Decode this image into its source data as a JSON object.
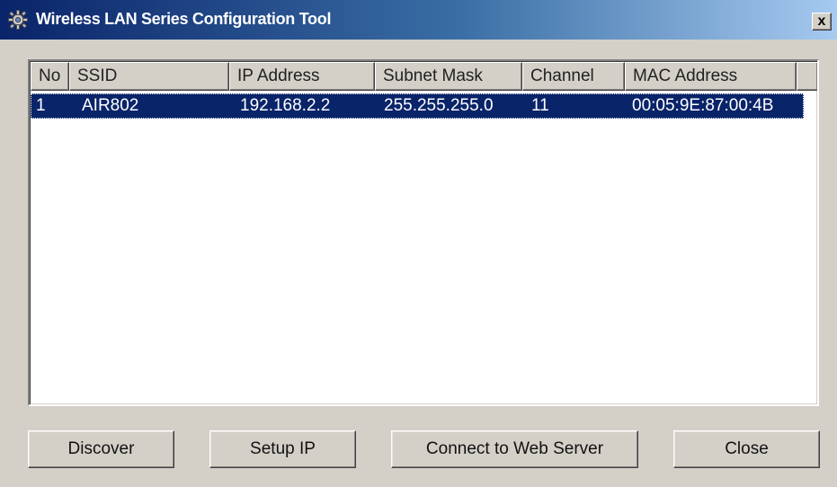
{
  "window": {
    "title": "Wireless LAN Series Configuration Tool",
    "close_label": "x"
  },
  "table": {
    "columns": [
      "No",
      "SSID",
      "IP Address",
      "Subnet Mask",
      "Channel",
      "MAC Address"
    ],
    "rows": [
      {
        "no": "1",
        "ssid": "AIR802",
        "ip": "192.168.2.2",
        "mask": "255.255.255.0",
        "channel": "11",
        "mac": "00:05:9E:87:00:4B",
        "selected": true
      }
    ]
  },
  "buttons": {
    "discover": "Discover",
    "setup_ip": "Setup IP",
    "connect": "Connect to Web Server",
    "close": "Close"
  },
  "colors": {
    "selection": "#0a246a",
    "face": "#d4d0c8",
    "title_start": "#0a246a",
    "title_end": "#a6caf0"
  }
}
